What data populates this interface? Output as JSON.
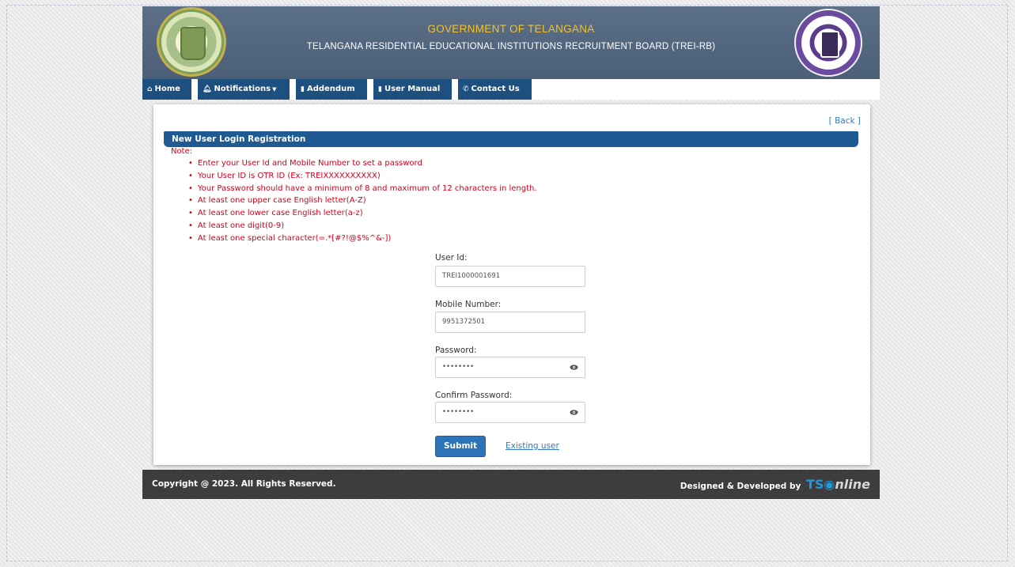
{
  "header": {
    "gov_title": "GOVERNMENT OF TELANGANA",
    "board_title": "TELANGANA RESIDENTIAL EDUCATIONAL INSTITUTIONS RECRUITMENT BOARD (TREI-RB)"
  },
  "nav": {
    "home": "Home",
    "notifications": "Notifications",
    "addendum": "Addendum",
    "user_manual": "User Manual",
    "contact": "Contact Us"
  },
  "panel": {
    "back": "[ Back ]",
    "section_title": "New User Login Registration",
    "note_label": "Note:",
    "notes": [
      "Enter your User Id and Mobile Number to set a password",
      "Your User ID is OTR ID (Ex: TREIXXXXXXXXXX)",
      "Your Password should have a minimum of 8 and maximum of 12 characters in length.",
      "At least one upper case English letter(A-Z)",
      "At least one lower case English letter(a-z)",
      "At least one digit(0-9)",
      "At least one special character(=.*[#?!@$%^&-])"
    ]
  },
  "form": {
    "user_id_label": "User Id:",
    "user_id_value": "TREI1000001691",
    "mobile_label": "Mobile Number:",
    "mobile_value": "9951372501",
    "password_label": "Password:",
    "password_value": "••••••••",
    "confirm_label": "Confirm Password:",
    "confirm_value": "••••••••",
    "submit_label": "Submit",
    "existing_user_label": "Existing user"
  },
  "footer": {
    "copyright": "Copyright @ 2023. All Rights Reserved.",
    "designed_by": "Designed & Developed by",
    "brand_ts": "TS",
    "brand_online": "nline"
  },
  "icons": {
    "home": "home-icon",
    "notifications": "bell-icon",
    "addendum": "file-icon",
    "user_manual": "book-icon",
    "contact": "phone-icon",
    "password_toggle": "eye-icon"
  },
  "colors": {
    "header_bg": "#4f637c",
    "gov_title": "#f4c22a",
    "nav_bg": "#1d4f7f",
    "section_bar": "#1f5a92",
    "note_text": "#d0021b",
    "submit_bg": "#2e73b8",
    "footer_bg": "#3d3d3d",
    "brand_blue": "#1e9ae0"
  }
}
